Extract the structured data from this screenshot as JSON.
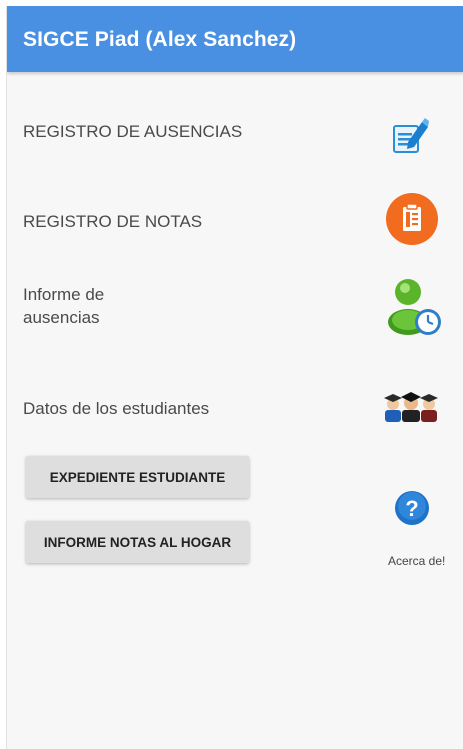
{
  "appbar": {
    "title": "SIGCE Piad (Alex Sanchez)"
  },
  "menu": {
    "registro_ausencias": {
      "label": "REGISTRO DE AUSENCIAS",
      "icon": "edit-document-icon"
    },
    "registro_notas": {
      "label": "REGISTRO DE NOTAS",
      "icon": "clipboard-icon"
    },
    "informe_ausencias": {
      "label_line1": "Informe de",
      "label_line2": "ausencias",
      "icon": "user-clock-icon"
    },
    "datos_estudiantes": {
      "label": "Datos de los estudiantes",
      "icon": "graduates-icon"
    }
  },
  "buttons": {
    "expediente": "EXPEDIENTE ESTUDIANTE",
    "informe_notas": "INFORME NOTAS AL HOGAR"
  },
  "about": {
    "label": "Acerca de!",
    "icon": "help-icon"
  },
  "colors": {
    "appbar": "#4a90e2",
    "notas_icon": "#f26c1f",
    "help_icon": "#1e73c8"
  }
}
